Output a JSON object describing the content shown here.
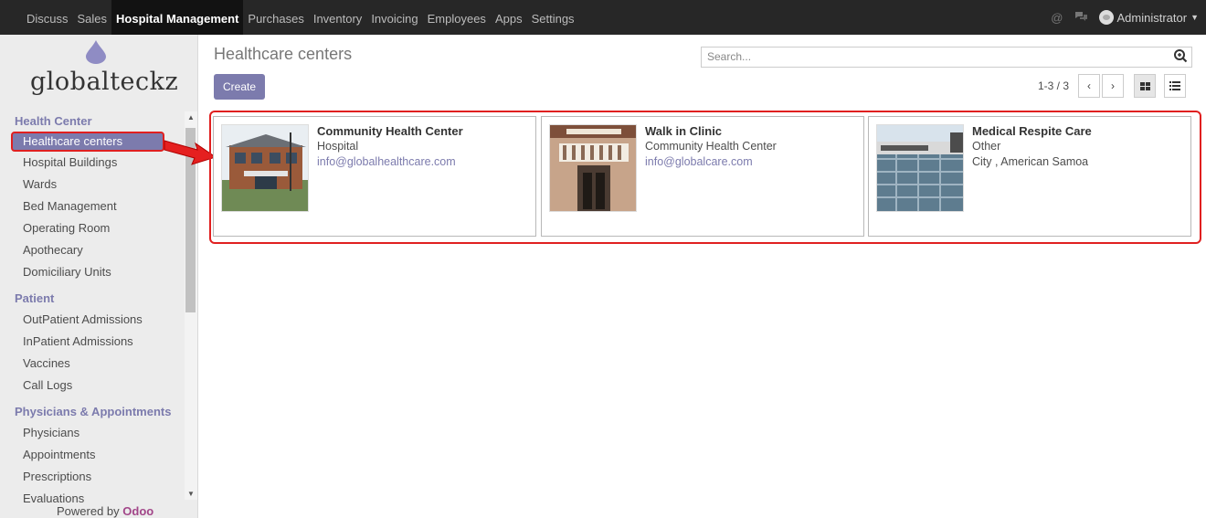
{
  "topbar": {
    "menu": [
      "Discuss",
      "Sales",
      "Hospital Management",
      "Purchases",
      "Inventory",
      "Invoicing",
      "Employees",
      "Apps",
      "Settings"
    ],
    "active": "Hospital Management",
    "user": "Administrator"
  },
  "sidebar": {
    "logo_text": "globalteckz",
    "sections": [
      {
        "header": "Health Center",
        "items": [
          "Healthcare centers",
          "Hospital Buildings",
          "Wards",
          "Bed Management",
          "Operating Room",
          "Apothecary",
          "Domiciliary Units"
        ]
      },
      {
        "header": "Patient",
        "items": [
          "OutPatient Admissions",
          "InPatient Admissions",
          "Vaccines",
          "Call Logs"
        ]
      },
      {
        "header": "Physicians & Appointments",
        "items": [
          "Physicians",
          "Appointments",
          "Prescriptions",
          "Evaluations"
        ]
      }
    ],
    "active_item": "Healthcare centers",
    "powered_by": "Powered by",
    "powered_brand": "Odoo"
  },
  "control": {
    "title": "Healthcare centers",
    "create_label": "Create",
    "search_placeholder": "Search...",
    "pager": "1-3 / 3"
  },
  "cards": [
    {
      "name": "Community Health Center",
      "type": "Hospital",
      "detail": "info@globalhealthcare.com",
      "detail_is_email": true,
      "image": "community-health-center-photo"
    },
    {
      "name": "Walk in Clinic",
      "type": "Community Health Center",
      "detail": "info@globalcare.com",
      "detail_is_email": true,
      "image": "walk-in-clinic-photo"
    },
    {
      "name": "Medical Respite Care",
      "type": "Other",
      "detail": "City , American Samoa",
      "detail_is_email": false,
      "image": "medical-center-photo"
    }
  ],
  "colors": {
    "brand": "#7c7bad",
    "topbar": "#272727",
    "highlight": "#e02020",
    "odoo": "#a24689"
  }
}
